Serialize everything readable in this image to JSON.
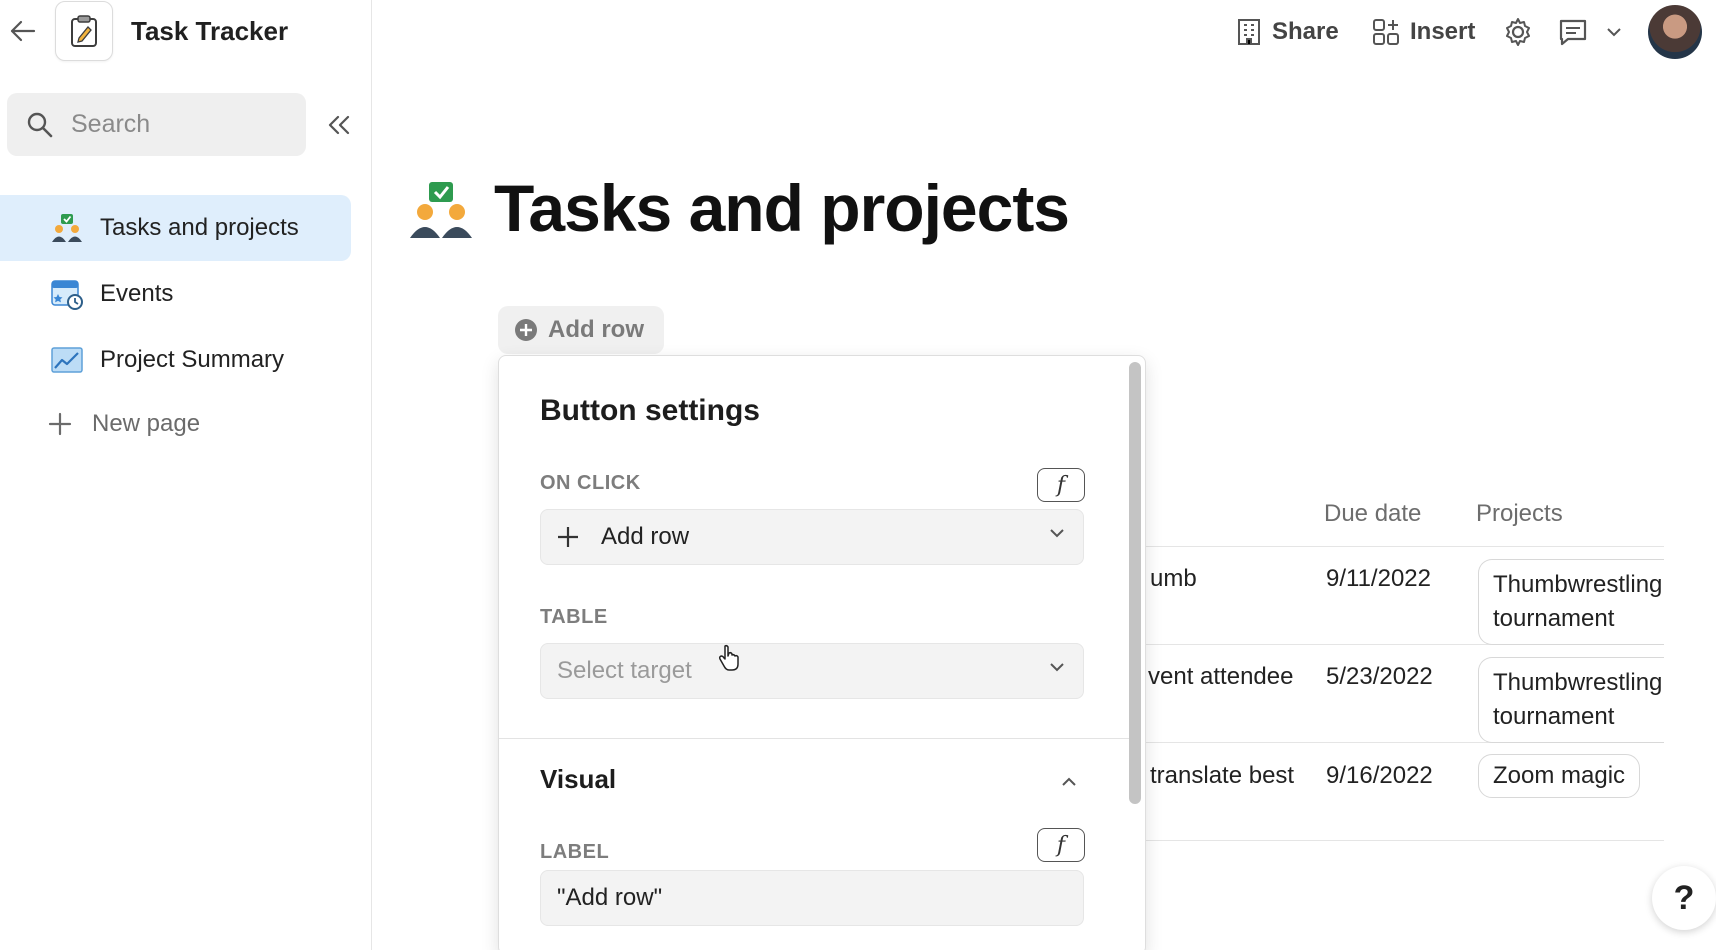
{
  "app": {
    "title": "Task Tracker"
  },
  "sidebar": {
    "search_placeholder": "Search",
    "items": [
      {
        "label": "Tasks and projects",
        "icon": "people-check-icon",
        "active": true
      },
      {
        "label": "Events",
        "icon": "calendar-clock-icon",
        "active": false
      },
      {
        "label": "Project Summary",
        "icon": "chart-icon",
        "active": false
      }
    ],
    "new_page_label": "New page"
  },
  "topbar": {
    "share_label": "Share",
    "insert_label": "Insert"
  },
  "page": {
    "title": "Tasks and projects",
    "add_row_label": "Add row"
  },
  "table": {
    "headers": {
      "due_date": "Due date",
      "projects": "Projects"
    },
    "rows": [
      {
        "task": "umb",
        "due": "9/11/2022",
        "project": "Thumbwrestling tournament"
      },
      {
        "task": "vent attendee",
        "due": "5/23/2022",
        "project": "Thumbwrestling tournament"
      },
      {
        "task": "translate best",
        "due": "9/16/2022",
        "project": "Zoom magic"
      }
    ]
  },
  "panel": {
    "title": "Button settings",
    "on_click_label": "ON CLICK",
    "on_click_value": "Add row",
    "table_label": "TABLE",
    "table_placeholder": "Select target",
    "visual_title": "Visual",
    "label_label": "LABEL",
    "label_value": "\"Add row\"",
    "fx_symbol": "f"
  },
  "help": {
    "symbol": "?"
  },
  "colors": {
    "active_nav_bg": "#dfeefc",
    "accent_green": "#2e9b4f",
    "accent_blue": "#3a86d4"
  }
}
